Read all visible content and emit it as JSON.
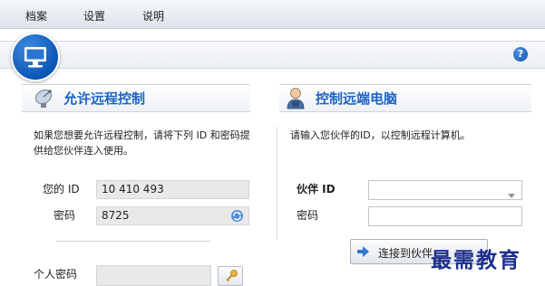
{
  "menu": {
    "items": [
      {
        "label": "档案"
      },
      {
        "label": "设置"
      },
      {
        "label": "说明"
      }
    ]
  },
  "allow_remote": {
    "title": "允许远程控制",
    "description": "如果您想要允许远程控制，请将下列 ID 和密码提供给您伙伴连入使用。",
    "your_id_label": "您的 ID",
    "your_id_value": "10 410 493",
    "password_label": "密码",
    "password_value": "8725",
    "personal_password_label": "个人密码",
    "personal_password_value": ""
  },
  "control_remote": {
    "title": "控制远端电脑",
    "description": "请输入您伙伴的ID，以控制远程计算机。",
    "partner_id_label": "伙伴 ID",
    "partner_id_value": "",
    "password_label": "密码",
    "password_value": "",
    "connect_button_label": "连接到伙伴"
  },
  "watermark": "最需教育",
  "colors": {
    "accent": "#1d64c4",
    "watermark": "#1d2f8f",
    "logo": "#0b56b4"
  }
}
